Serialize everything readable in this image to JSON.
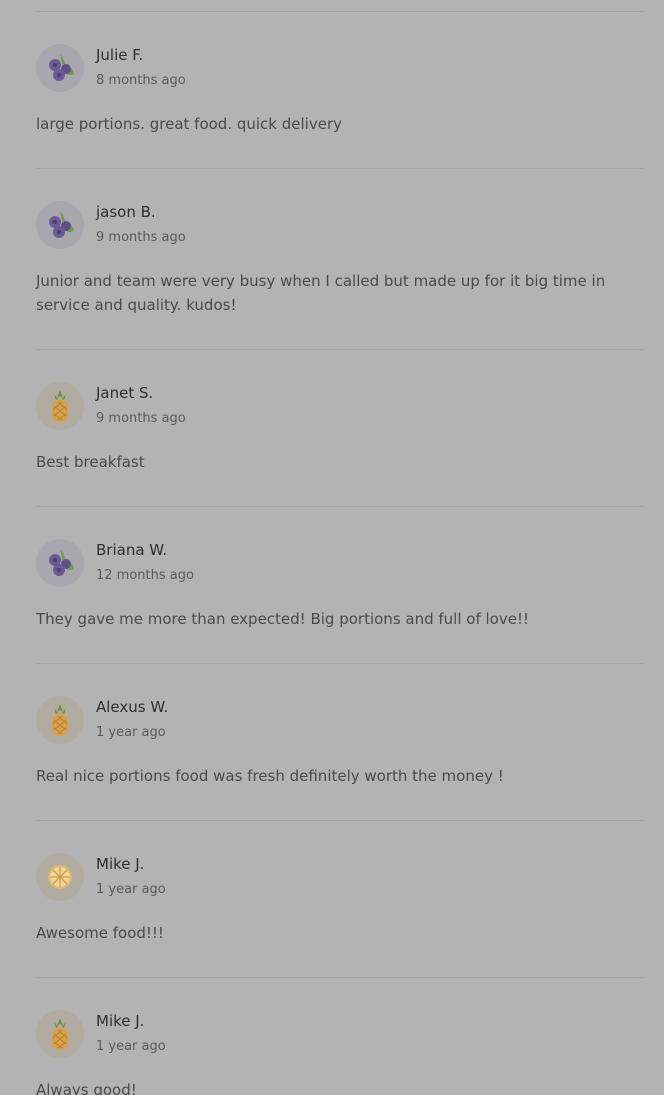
{
  "reviews": [
    {
      "name": "Julie F.",
      "time": "8 months ago",
      "text": "large portions. great food. quick delivery",
      "avatar": "blueberry-icon"
    },
    {
      "name": "jason B.",
      "time": "9 months ago",
      "text": "Junior and team were very busy when I called but made up for it big time in service and quality. kudos!",
      "avatar": "blueberry-icon"
    },
    {
      "name": "Janet S.",
      "time": "9 months ago",
      "text": "Best breakfast",
      "avatar": "pineapple-icon"
    },
    {
      "name": "Briana W.",
      "time": "12 months ago",
      "text": "They gave me more than expected! Big portions and full of love!!",
      "avatar": "blueberry-icon"
    },
    {
      "name": "Alexus W.",
      "time": "1 year ago",
      "text": "Real nice portions food was fresh definitely worth the money !",
      "avatar": "pineapple-icon"
    },
    {
      "name": "Mike J.",
      "time": "1 year ago",
      "text": "Awesome food!!!",
      "avatar": "orange-slice-icon"
    },
    {
      "name": "Mike J.",
      "time": "1 year ago",
      "text": "Always good!",
      "avatar": "pineapple-icon"
    }
  ],
  "colors": {
    "overlay_background": "#b3b3b3",
    "divider": "#a6a6a6",
    "name_text": "#2f2f2f",
    "body_text": "#4a4a4a"
  }
}
